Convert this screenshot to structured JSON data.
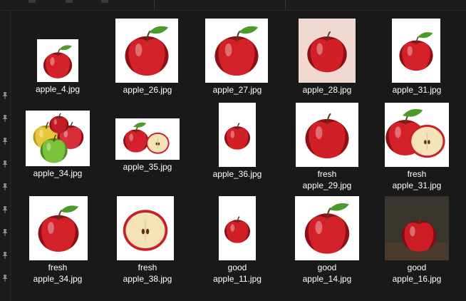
{
  "toolbar": {
    "icons": [
      "view-icon",
      "sort-icon",
      "filter-icon"
    ]
  },
  "navigation": {
    "pin_icons": 9
  },
  "files": [
    {
      "line1": "",
      "line2": "apple_4.jpg",
      "variant": "leaf-apple",
      "bg": "#ffffff"
    },
    {
      "line1": "",
      "line2": "apple_26.jpg",
      "variant": "leaf-apple",
      "bg": "#ffffff"
    },
    {
      "line1": "",
      "line2": "apple_27.jpg",
      "variant": "leaf-apple",
      "bg": "#ffffff"
    },
    {
      "line1": "",
      "line2": "apple_28.jpg",
      "variant": "apple",
      "bg": "#f1d9d2"
    },
    {
      "line1": "",
      "line2": "apple_31.jpg",
      "variant": "leaf-apple",
      "bg": "#ffffff"
    },
    {
      "line1": "",
      "line2": "apple_34.jpg",
      "variant": "trio",
      "bg": "#ffffff"
    },
    {
      "line1": "",
      "line2": "apple_35.jpg",
      "variant": "whole-and-half",
      "bg": "#ffffff"
    },
    {
      "line1": "",
      "line2": "apple_36.jpg",
      "variant": "apple",
      "bg": "#ffffff"
    },
    {
      "line1": "fresh",
      "line2": "apple_29.jpg",
      "variant": "apple",
      "bg": "#ffffff"
    },
    {
      "line1": "fresh",
      "line2": "apple_31.jpg",
      "variant": "whole-and-half",
      "bg": "#ffffff"
    },
    {
      "line1": "fresh",
      "line2": "apple_34.jpg",
      "variant": "leaf-apple",
      "bg": "#ffffff"
    },
    {
      "line1": "fresh",
      "line2": "apple_38.jpg",
      "variant": "half",
      "bg": "#ffffff"
    },
    {
      "line1": "good",
      "line2": "apple_11.jpg",
      "variant": "apple",
      "bg": "#ffffff"
    },
    {
      "line1": "good",
      "line2": "apple_14.jpg",
      "variant": "leaf-apple",
      "bg": "#ffffff"
    },
    {
      "line1": "good",
      "line2": "apple_16.jpg",
      "variant": "dark-apple",
      "bg": "#3b3530"
    }
  ]
}
